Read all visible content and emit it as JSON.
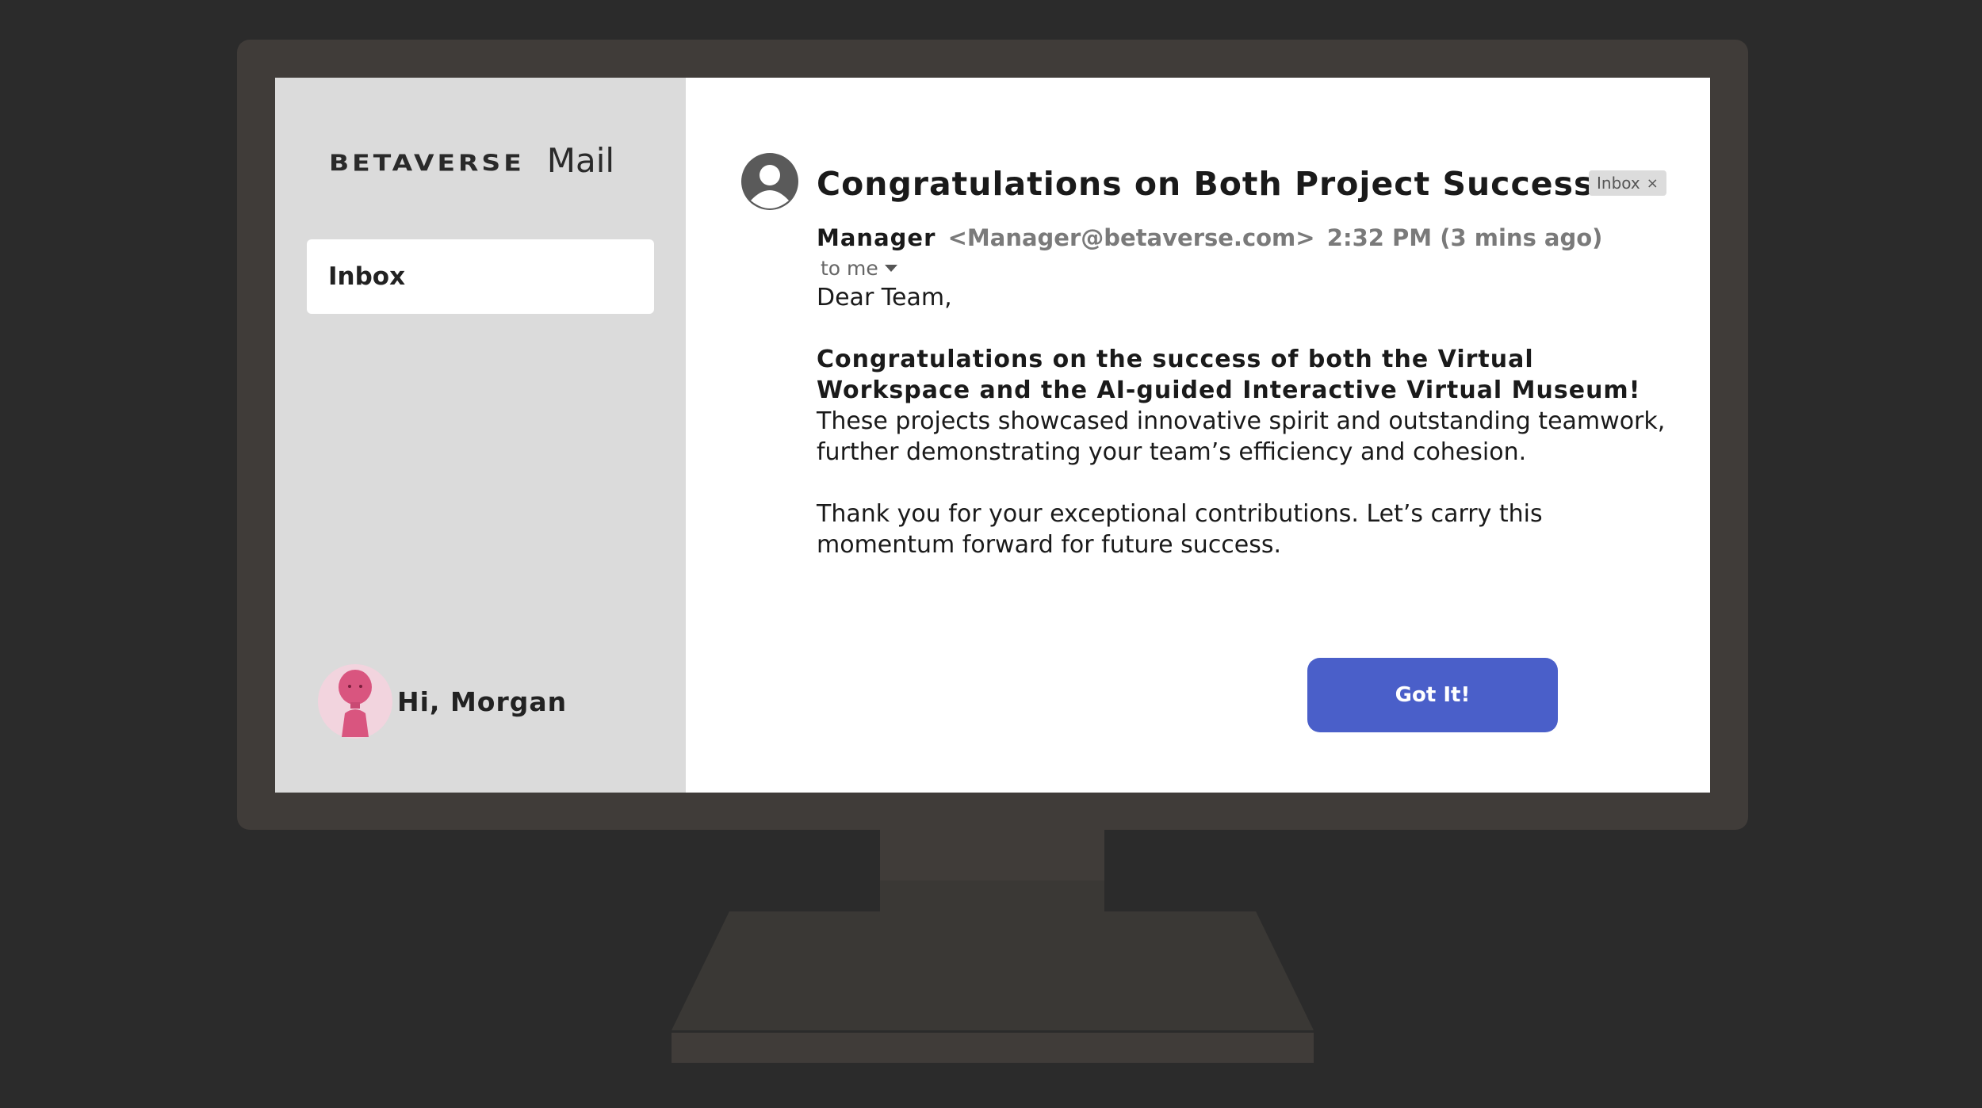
{
  "sidebar": {
    "brand_logo": "BETAVERSE",
    "brand_app": "Mail",
    "nav_items": [
      {
        "label": "Inbox"
      }
    ],
    "user": {
      "greeting": "Hi, Morgan"
    }
  },
  "email": {
    "subject": "Congratulations on Both Project Successes",
    "label_chip": "Inbox",
    "label_chip_close": "×",
    "from_name": "Manager",
    "from_address": "<Manager@betaverse.com>",
    "time": "2:32 PM (3 mins ago)",
    "to": "to me",
    "greeting": "Dear Team,",
    "paragraph1_bold": "Congratulations on the success of both the Virtual Workspace and the AI-guided Interactive Virtual Museum!",
    "paragraph1_rest": " These projects showcased innovative spirit and outstanding teamwork, further demonstrating your team’s efficiency and cohesion.",
    "paragraph2": "Thank you for your exceptional contributions. Let’s carry this momentum forward for future success."
  },
  "actions": {
    "got_it_label": "Got It!"
  },
  "colors": {
    "background": "#2b2b2b",
    "monitor_bezel": "#403c39",
    "sidebar": "#dbdbdb",
    "accent_button": "#4a5fc9"
  },
  "icons": {
    "sender_avatar": "person-circle-icon",
    "user_avatar": "pink-character-avatar",
    "to_dropdown": "caret-down-icon"
  }
}
